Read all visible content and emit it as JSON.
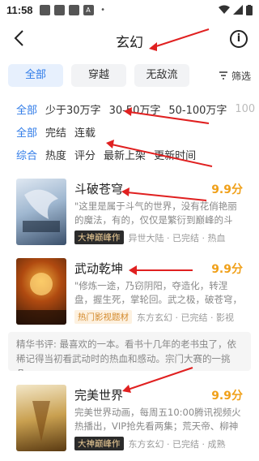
{
  "status": {
    "time": "11:58",
    "notif_icons": [
      "app-icon",
      "app-icon",
      "app-icon",
      "a-icon"
    ]
  },
  "header": {
    "title": "玄幻"
  },
  "tabs": [
    {
      "label": "全部",
      "active": true
    },
    {
      "label": "穿越",
      "active": false
    },
    {
      "label": "无敌流",
      "active": false
    }
  ],
  "filter_label": "筛选",
  "word_filter": [
    "全部",
    "少于30万字",
    "30-50万字",
    "50-100万字",
    "100"
  ],
  "status_filter": [
    "全部",
    "完结",
    "连载"
  ],
  "sort_filter": [
    "综合",
    "热度",
    "评分",
    "最新上架",
    "更新时间"
  ],
  "books": [
    {
      "title": "斗破苍穹",
      "score": "9.9分",
      "desc": "\"这里是属于斗气的世界，没有花俏艳丽的魔法，有的，仅仅是繁衍到巅峰的斗气！ 新...",
      "badge": "大神巅峰作",
      "tags": "异世大陆 · 已完结 · 热血"
    },
    {
      "title": "武动乾坤",
      "score": "9.9分",
      "desc": "\"修炼一途，乃窃阴阳，夺造化，转涅盘，握生死，掌轮回。武之极，破苍穹，动乾...",
      "badge": "热门影视题材",
      "tags": "东方玄幻 · 已完结 · 影视"
    },
    {
      "title": "完美世界",
      "score": "9.9分",
      "desc": "完美世界动画，每周五10:00腾讯视频火热播出，VIP抢先看两集；荒天帝、柳神等待...",
      "badge": "大神巅峰作",
      "tags": "东方玄幻 · 已完结 · 成熟"
    }
  ],
  "quote": "精华书评: 最喜欢的一本。看书十几年的老书虫了，依稀记得当初看武动时的热血和感动。宗门大赛的一挑几...",
  "colors": {
    "accent": "#2f7be8",
    "score": "#f0a019",
    "arrow": "#e02020"
  }
}
